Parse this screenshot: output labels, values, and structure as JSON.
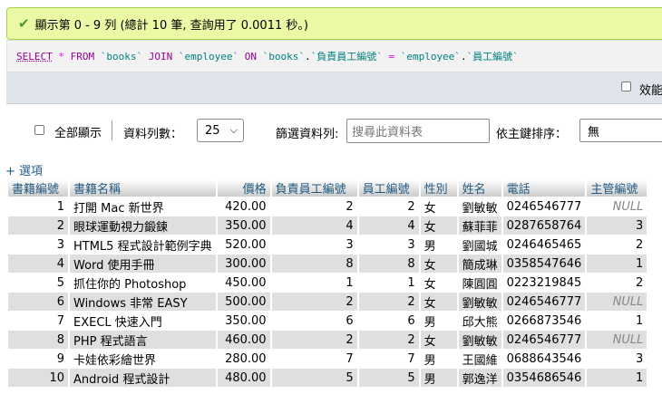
{
  "success": {
    "message": "顯示第 0 - 9 列 (總計 10 筆, 查詢用了 0.0011 秒。)"
  },
  "sql": {
    "select": "SELECT",
    "star": "*",
    "from": "FROM",
    "books": "`books`",
    "join": "JOIN",
    "employee": "`employee`",
    "on": "ON",
    "dot": ".",
    "col_left": "`負責員工編號`",
    "eq": "=",
    "col_right": "`員工編號`"
  },
  "profiling": {
    "label": "效能"
  },
  "nav": {
    "show_all_label": "全部顯示",
    "rows_label": "資料列數：",
    "rows_value": "25",
    "filter_label": "篩選資料列:",
    "filter_placeholder": "搜尋此資料表",
    "sort_label": "依主鍵排序：",
    "sort_value": "無"
  },
  "options_link": "+ 選項",
  "table": {
    "headers": [
      "書籍編號",
      "書籍名稱",
      "價格",
      "負責員工編號",
      "員工編號",
      "性別",
      "姓名",
      "電話",
      "主管編號"
    ],
    "rows": [
      [
        "1",
        "打開 Mac 新世界",
        "420.00",
        "2",
        "2",
        "女",
        "劉敏敏",
        "0246546777",
        "NULL"
      ],
      [
        "2",
        "眼球運動視力鍛鍊",
        "350.00",
        "4",
        "4",
        "女",
        "蘇菲菲",
        "0287658764",
        "3"
      ],
      [
        "3",
        "HTML5 程式設計範例字典",
        "520.00",
        "3",
        "3",
        "男",
        "劉國城",
        "0246465465",
        "2"
      ],
      [
        "4",
        "Word 使用手冊",
        "300.00",
        "8",
        "8",
        "女",
        "簡成琳",
        "0358547646",
        "1"
      ],
      [
        "5",
        "抓住你的 Photoshop",
        "450.00",
        "1",
        "1",
        "女",
        "陳圓圓",
        "0223219845",
        "2"
      ],
      [
        "6",
        "Windows 非常 EASY",
        "500.00",
        "2",
        "2",
        "女",
        "劉敏敏",
        "0246546777",
        "NULL"
      ],
      [
        "7",
        "EXECL 快速入門",
        "350.00",
        "6",
        "6",
        "男",
        "邱大熊",
        "0266873546",
        "1"
      ],
      [
        "8",
        "PHP 程式語言",
        "460.00",
        "2",
        "2",
        "女",
        "劉敏敏",
        "0246546777",
        "NULL"
      ],
      [
        "9",
        "卡娃依彩繪世界",
        "280.00",
        "7",
        "7",
        "男",
        "王國維",
        "0688643546",
        "3"
      ],
      [
        "10",
        "Android 程式設計",
        "480.00",
        "5",
        "5",
        "男",
        "郭逸洋",
        "0354686546",
        "1"
      ]
    ]
  }
}
